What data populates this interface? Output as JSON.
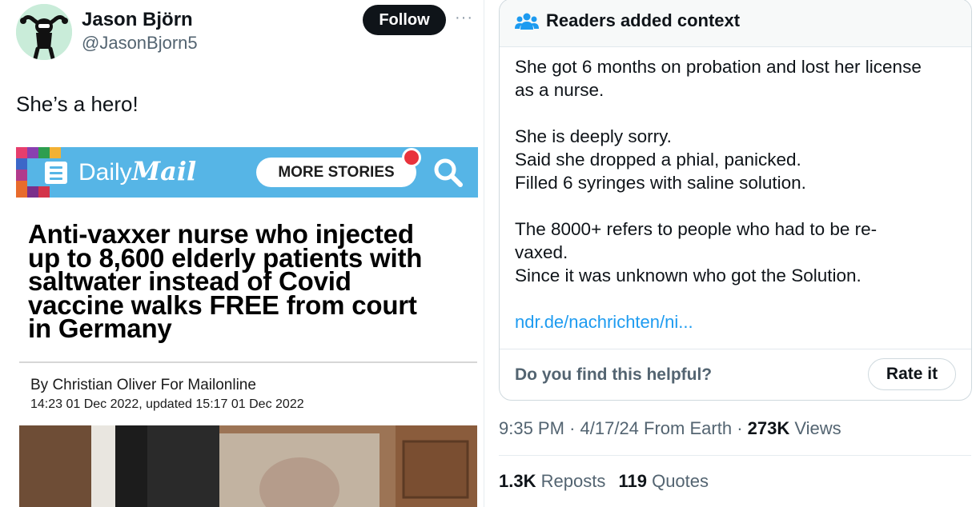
{
  "tweet": {
    "author_name": "Jason Björn",
    "author_handle": "@JasonBjorn5",
    "follow_label": "Follow",
    "more_label": "···",
    "text": "She’s a hero!",
    "avatar_icon": "cartoon-figure-avatar"
  },
  "article": {
    "brand_daily": "Daily",
    "brand_mail": "Mail",
    "more_stories": "MORE STORIES",
    "headline_lines": [
      "Anti-vaxxer nurse who injected",
      "up to 8,600 elderly patients with",
      "saltwater instead of Covid",
      "vaccine walks FREE from court",
      "in Germany"
    ],
    "byline": "By Christian Oliver For Mailonline",
    "dateline": "14:23 01 Dec 2022, updated 15:17 01 Dec 2022",
    "banner_color": "#56b5e6"
  },
  "note": {
    "title": "Readers added context",
    "icon": "people-icon",
    "paragraphs": [
      "She got 6 months on probation and lost her license\nas a nurse.",
      "She is deeply sorry.\nSaid she dropped a phial, panicked.\nFilled 6 syringes with saline solution.",
      "The 8000+ refers to people who had to be re-\nvaxed.\nSince it was unknown who got the Solution."
    ],
    "link": "ndr.de/nachrichten/ni...",
    "helpful_question": "Do you find this helpful?",
    "rate_label": "Rate it",
    "link_color": "#1d9bf0"
  },
  "meta": {
    "time": "9:35 PM",
    "date": "4/17/24",
    "source": "From Earth",
    "separator": "·",
    "views_count": "273K",
    "views_label": "Views"
  },
  "stats": {
    "reposts_count": "1.3K",
    "reposts_label": "Reposts",
    "quotes_count": "119",
    "quotes_label": "Quotes"
  }
}
